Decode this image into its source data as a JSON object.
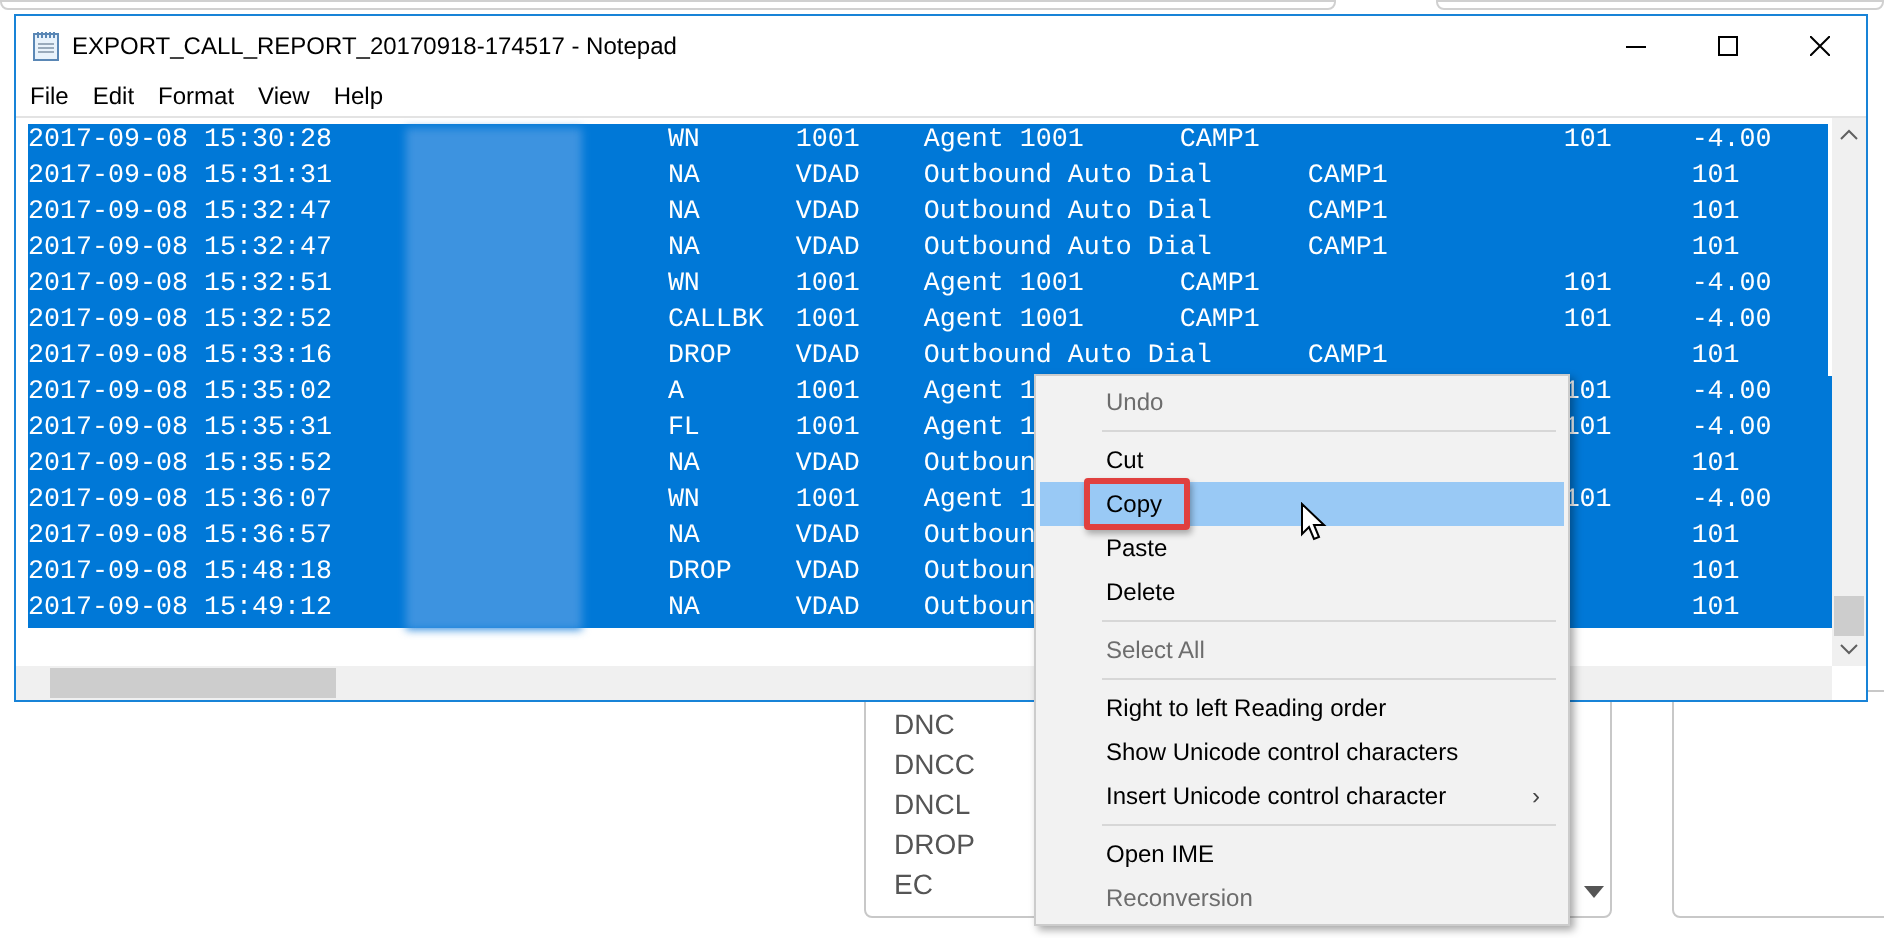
{
  "window": {
    "title": "EXPORT_CALL_REPORT_20170918-174517 - Notepad"
  },
  "menu_bar": [
    "File",
    "Edit",
    "Format",
    "View",
    "Help"
  ],
  "text_lines": [
    {
      "text": "2017-09-08 15:30:28\t\t\tWN\t1001\tAgent 1001\tCAMP1\t\t\t101\t-4.00"
    },
    {
      "text": "2017-09-08 15:31:31\t\t\tNA\tVDAD\tOutbound Auto Dial\tCAMP1\t\t\t101"
    },
    {
      "text": "2017-09-08 15:32:47\t\t\tNA\tVDAD\tOutbound Auto Dial\tCAMP1\t\t\t101"
    },
    {
      "text": "2017-09-08 15:32:47\t\t\tNA\tVDAD\tOutbound Auto Dial\tCAMP1\t\t\t101"
    },
    {
      "text": "2017-09-08 15:32:51\t\t\tWN\t1001\tAgent 1001\tCAMP1\t\t\t101\t-4.00"
    },
    {
      "text": "2017-09-08 15:32:52\t\t\tCALLBK\t1001\tAgent 1001\tCAMP1\t\t\t101\t-4.00"
    },
    {
      "text": "2017-09-08 15:33:16\t\t\tDROP\tVDAD\tOutbound Auto Dial\tCAMP1\t\t\t101"
    },
    {
      "text": "2017-09-08 15:35:02\t\t\tA\t1001\tAgent 1",
      "text_after_menu": "101\t-4.00"
    },
    {
      "text": "2017-09-08 15:35:31\t\t\tFL\t1001\tAgent 1",
      "text_after_menu": "101\t-4.00"
    },
    {
      "text": "2017-09-08 15:35:52\t\t\tNA\tVDAD\tOutboun",
      "text_after_menu": "\t101"
    },
    {
      "text": "2017-09-08 15:36:07\t\t\tWN\t1001\tAgent 1",
      "text_after_menu": "101\t-4.00"
    },
    {
      "text": "2017-09-08 15:36:57\t\t\tNA\tVDAD\tOutboun",
      "text_after_menu": "\t101"
    },
    {
      "text": "2017-09-08 15:48:18\t\t\tDROP\tVDAD\tOutboun",
      "text_after_menu": "\t101"
    },
    {
      "text": "2017-09-08 15:49:12\t\t\tNA\tVDAD\tOutboun",
      "text_after_menu": "\t101"
    }
  ],
  "background_list": [
    "DNC",
    "DNCC",
    "DNCL",
    "DROP",
    "EC"
  ],
  "context_menu": [
    {
      "kind": "item",
      "label": "Undo",
      "disabled": true,
      "selected": false
    },
    {
      "kind": "separator"
    },
    {
      "kind": "item",
      "label": "Cut",
      "disabled": false,
      "selected": false
    },
    {
      "kind": "item",
      "label": "Copy",
      "disabled": false,
      "selected": true
    },
    {
      "kind": "item",
      "label": "Paste",
      "disabled": false,
      "selected": false
    },
    {
      "kind": "item",
      "label": "Delete",
      "disabled": false,
      "selected": false
    },
    {
      "kind": "separator"
    },
    {
      "kind": "item",
      "label": "Select All",
      "disabled": true,
      "selected": false
    },
    {
      "kind": "separator"
    },
    {
      "kind": "item",
      "label": "Right to left Reading order",
      "disabled": false,
      "selected": false
    },
    {
      "kind": "item",
      "label": "Show Unicode control characters",
      "disabled": false,
      "selected": false
    },
    {
      "kind": "submenu",
      "label": "Insert Unicode control character",
      "disabled": false,
      "selected": false,
      "arrow": "›"
    },
    {
      "kind": "separator"
    },
    {
      "kind": "item",
      "label": "Open IME",
      "disabled": false,
      "selected": false
    },
    {
      "kind": "item",
      "label": "Reconversion",
      "disabled": true,
      "selected": false
    }
  ]
}
